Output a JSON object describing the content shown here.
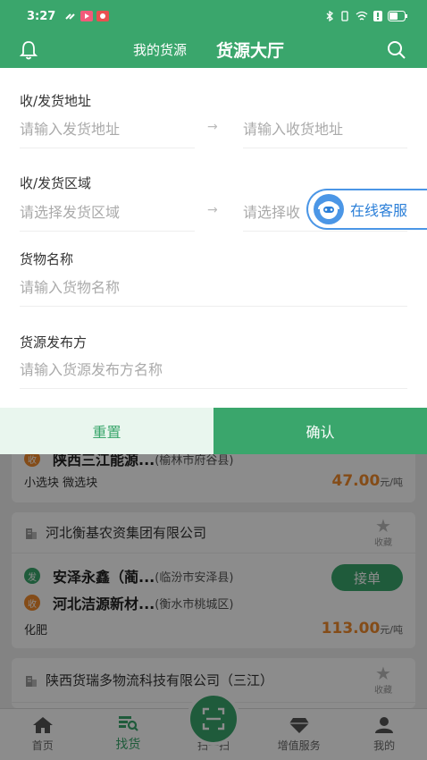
{
  "status": {
    "time": "3:27",
    "battery": "■"
  },
  "nav": {
    "mine": "我的货源",
    "hall": "货源大厅"
  },
  "filter": {
    "address_label": "收/发货地址",
    "send_address_placeholder": "请输入发货地址",
    "recv_address_placeholder": "请输入收货地址",
    "region_label": "收/发货区域",
    "send_region_placeholder": "请选择发货区域",
    "recv_region_placeholder": "请选择收",
    "goods_label": "货物名称",
    "goods_placeholder": "请输入货物名称",
    "publisher_label": "货源发布方",
    "publisher_placeholder": "请输入货源发布方名称",
    "arrow": "→",
    "reset": "重置",
    "confirm": "确认"
  },
  "service": {
    "label": "在线客服"
  },
  "list": {
    "card0": {
      "recv_place": "陕西三江能源...",
      "recv_sub": "(榆林市府谷县)",
      "goods": "小选块 微选块",
      "price": "47.00",
      "unit": "元/吨",
      "recv_tag": "收"
    },
    "card1": {
      "company": "河北衡基农资集团有限公司",
      "fav": "收藏",
      "send_tag": "发",
      "send_place": "安泽永鑫（蔺...",
      "send_sub": "(临汾市安泽县)",
      "recv_tag": "收",
      "recv_place": "河北洁源新材...",
      "recv_sub": "(衡水市桃城区)",
      "accept": "接单",
      "goods": "化肥",
      "price": "113.00",
      "unit": "元/吨"
    },
    "card2": {
      "company": "陕西货瑞多物流科技有限公司（三江）",
      "fav": "收藏"
    }
  },
  "tabs": {
    "home": "首页",
    "find": "找货",
    "scan": "扫一扫",
    "value": "增值服务",
    "mine": "我的"
  },
  "colors": {
    "primary": "#3aa66c",
    "accent_orange": "#f08a2c",
    "service_blue": "#2b7fd8"
  }
}
